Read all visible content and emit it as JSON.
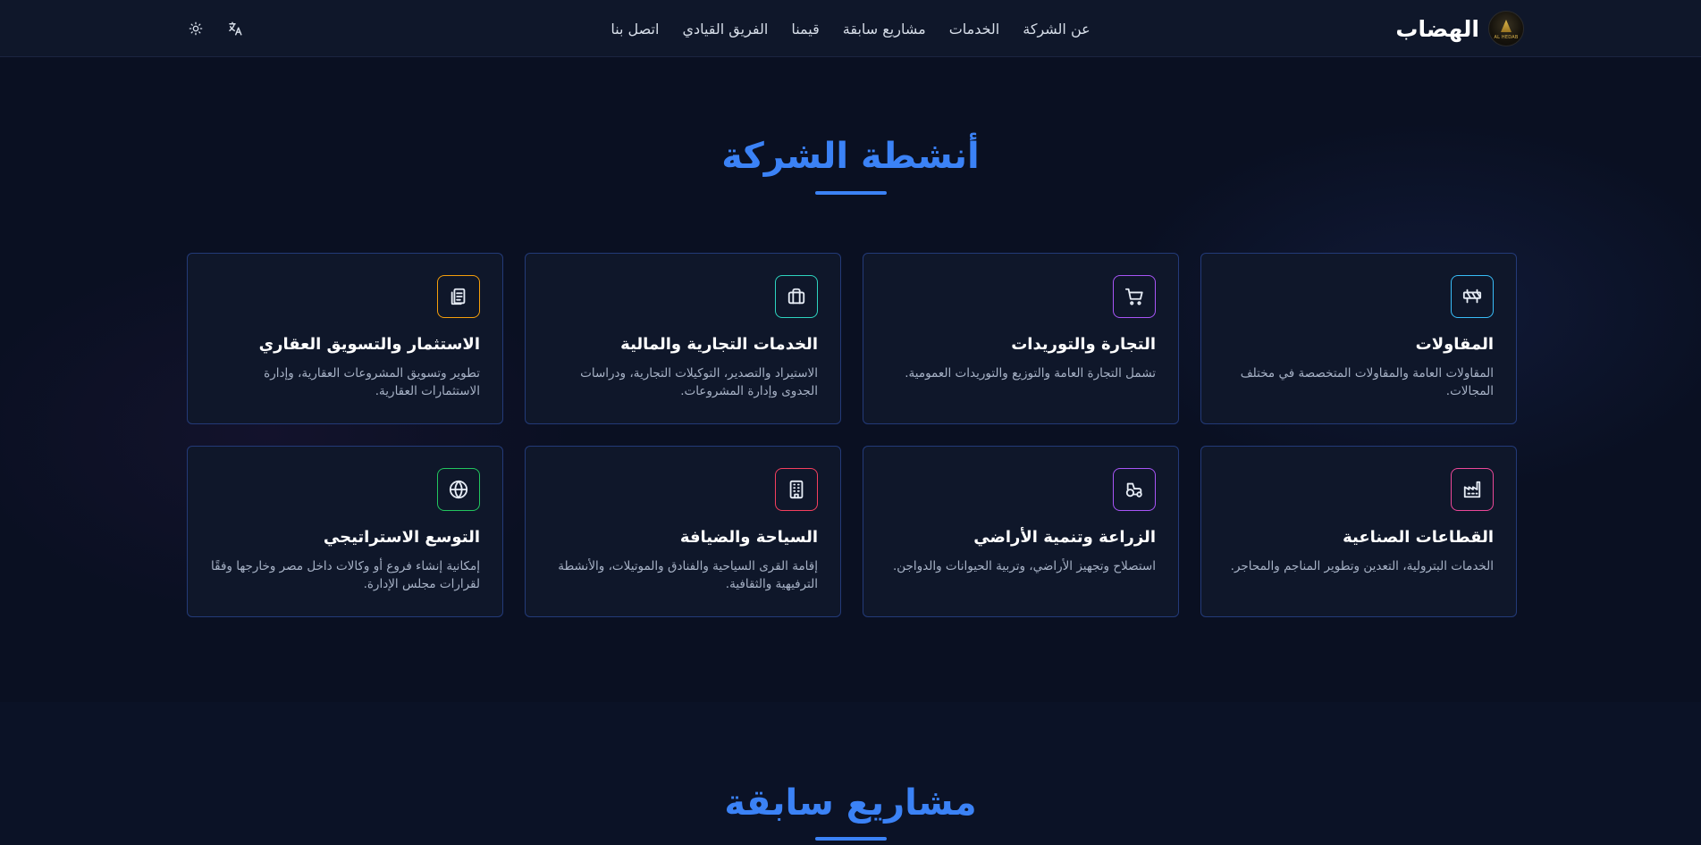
{
  "header": {
    "brand": "الهضاب",
    "logo_text": "AL HEDAB",
    "nav": [
      "عن الشركة",
      "الخدمات",
      "مشاريع سابقة",
      "قيمنا",
      "الفريق القيادي",
      "اتصل بنا"
    ]
  },
  "activities": {
    "title": "أنشطة الشركة",
    "cards": [
      {
        "title": "المقاولات",
        "desc": "المقاولات العامة والمقاولات المتخصصة في مختلف المجالات.",
        "icon": "barrier-icon",
        "color": "#38bdf8"
      },
      {
        "title": "التجارة والتوريدات",
        "desc": "تشمل التجارة العامة والتوزيع والتوريدات العمومية.",
        "icon": "cart-icon",
        "color": "#a855f7"
      },
      {
        "title": "الخدمات التجارية والمالية",
        "desc": "الاستيراد والتصدير، التوكيلات التجارية، ودراسات الجدوى وإدارة المشروعات.",
        "icon": "briefcase-icon",
        "color": "#2dd4bf"
      },
      {
        "title": "الاستثمار والتسويق العقاري",
        "desc": "تطوير وتسويق المشروعات العقارية، وإدارة الاستثمارات العقارية.",
        "icon": "documents-icon",
        "color": "#f59e0b"
      },
      {
        "title": "القطاعات الصناعية",
        "desc": "الخدمات البترولية، التعدين وتطوير المناجم والمحاجر.",
        "icon": "factory-icon",
        "color": "#ec4899"
      },
      {
        "title": "الزراعة وتنمية الأراضي",
        "desc": "استصلاح وتجهيز الأراضي، وتربية الحيوانات والدواجن.",
        "icon": "tractor-icon",
        "color": "#a855f7"
      },
      {
        "title": "السياحة والضيافة",
        "desc": "إقامة القرى السياحية والفنادق والموتيلات، والأنشطة الترفيهية والثقافية.",
        "icon": "building-icon",
        "color": "#f43f5e"
      },
      {
        "title": "التوسع الاستراتيجي",
        "desc": "إمكانية إنشاء فروع أو وكالات داخل مصر وخارجها وفقًا لقرارات مجلس الإدارة.",
        "icon": "globe-icon",
        "color": "#22c55e"
      }
    ]
  },
  "projects": {
    "title": "مشاريع سابقة"
  },
  "colors": {
    "accent": "#3b82f6",
    "background": "#0a1022",
    "card": "#0f172a"
  }
}
